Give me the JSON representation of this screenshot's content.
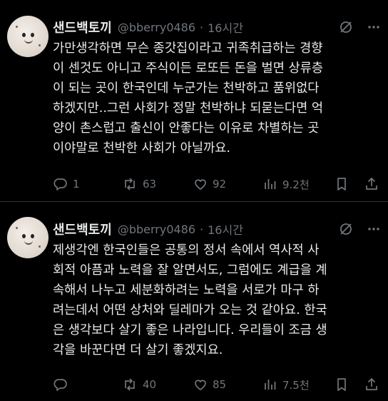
{
  "colors": {
    "background": "#000000",
    "text": "#e7e9ea",
    "muted": "#71767b",
    "divider": "#2f3336"
  },
  "posts": [
    {
      "author": "샌드백토끼",
      "handle": "@bberry0486",
      "separator": "·",
      "time": "16시간",
      "text": "가만생각하면 무슨 종갓집이라고 귀족취급하는 경향\n이 센것도 아니고 주식이든 로또든 돈을 벌면 상류층\n이 되는 곳이 한국인데 누군가는 천박하고 품위없다\n하겠지만..그런 사회가 정말 천박하냐 되묻는다면 억\n양이 촌스럽고 출신이 안좋다는 이유로 차별하는 곳\n이야말로 천박한 사회가 아닐까요.",
      "replies": "1",
      "reposts": "63",
      "likes": "92",
      "views": "9.2천",
      "icons": [
        "grok-icon",
        "more-icon",
        "reply-icon",
        "repost-icon",
        "like-icon",
        "views-icon",
        "bookmark-icon",
        "share-icon"
      ]
    },
    {
      "author": "샌드백토끼",
      "handle": "@bberry0486",
      "separator": "·",
      "time": "16시간",
      "text": "제생각엔 한국인들은 공통의 정서 속에서 역사적 사\n회적 아픔과 노력을 잘 알면서도, 그럼에도 계급을 계\n속해서 나누고 세분화하려는 노력을 서로가 마구 하\n려는데서 어떤 상처와 딜레마가 오는 것 같아요. 한국\n은 생각보다 살기 좋은 나라입니다. 우리들이 조금 생\n각을 바꾼다면 더 살기 좋겠지요.",
      "replies": "",
      "reposts": "40",
      "likes": "85",
      "views": "7.5천"
    }
  ]
}
